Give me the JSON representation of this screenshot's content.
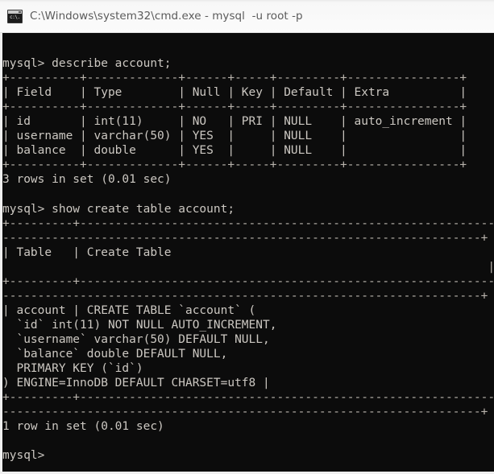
{
  "window": {
    "title": "C:\\Windows\\system32\\cmd.exe - mysql  -u root -p",
    "icon": "cmd-console-icon",
    "icon_text": "c:\\."
  },
  "colors": {
    "titlebar_bg": "#fbfbfb",
    "titlebar_text": "#5b5b5b",
    "terminal_bg": "#0c0c0c",
    "terminal_text": "#ccc8c2",
    "frame_bg": "#efefef"
  },
  "terminal": {
    "prompt": "mysql>",
    "commands": [
      "describe account;",
      "show create table account;"
    ],
    "describe_result": {
      "columns": [
        "Field",
        "Type",
        "Null",
        "Key",
        "Default",
        "Extra"
      ],
      "rows": [
        [
          "id",
          "int(11)",
          "NO",
          "PRI",
          "NULL",
          "auto_increment"
        ],
        [
          "username",
          "varchar(50)",
          "YES",
          "",
          "NULL",
          ""
        ],
        [
          "balance",
          "double",
          "YES",
          "",
          "NULL",
          ""
        ]
      ],
      "status": "3 rows in set (0.01 sec)"
    },
    "show_create_result": {
      "columns": [
        "Table",
        "Create Table"
      ],
      "table_name": "account",
      "create_statement_lines": [
        "CREATE TABLE `account` (",
        "  `id` int(11) NOT NULL AUTO_INCREMENT,",
        "  `username` varchar(50) DEFAULT NULL,",
        "  `balance` double DEFAULT NULL,",
        "  PRIMARY KEY (`id`)",
        ") ENGINE=InnoDB DEFAULT CHARSET=utf8"
      ],
      "status": "1 row in set (0.01 sec)"
    },
    "lines": [
      "",
      "mysql> describe account;",
      "+----------+-------------+------+-----+---------+----------------+",
      "| Field    | Type        | Null | Key | Default | Extra          |",
      "+----------+-------------+------+-----+---------+----------------+",
      "| id       | int(11)     | NO   | PRI | NULL    | auto_increment |",
      "| username | varchar(50) | YES  |     | NULL    |                |",
      "| balance  | double      | YES  |     | NULL    |                |",
      "+----------+-------------+------+-----+---------+----------------+",
      "3 rows in set (0.01 sec)",
      "",
      "mysql> show create table account;",
      "+---------+------------------------------------------------------------",
      "--------------------------------------------------------------------+",
      "| Table   | Create Table",
      "                                                                     |",
      "+---------+------------------------------------------------------------",
      "--------------------------------------------------------------------+",
      "| account | CREATE TABLE `account` (",
      "  `id` int(11) NOT NULL AUTO_INCREMENT,",
      "  `username` varchar(50) DEFAULT NULL,",
      "  `balance` double DEFAULT NULL,",
      "  PRIMARY KEY (`id`)",
      ") ENGINE=InnoDB DEFAULT CHARSET=utf8 |",
      "+---------+------------------------------------------------------------",
      "--------------------------------------------------------------------+",
      "1 row in set (0.01 sec)",
      "",
      "mysql>"
    ]
  }
}
